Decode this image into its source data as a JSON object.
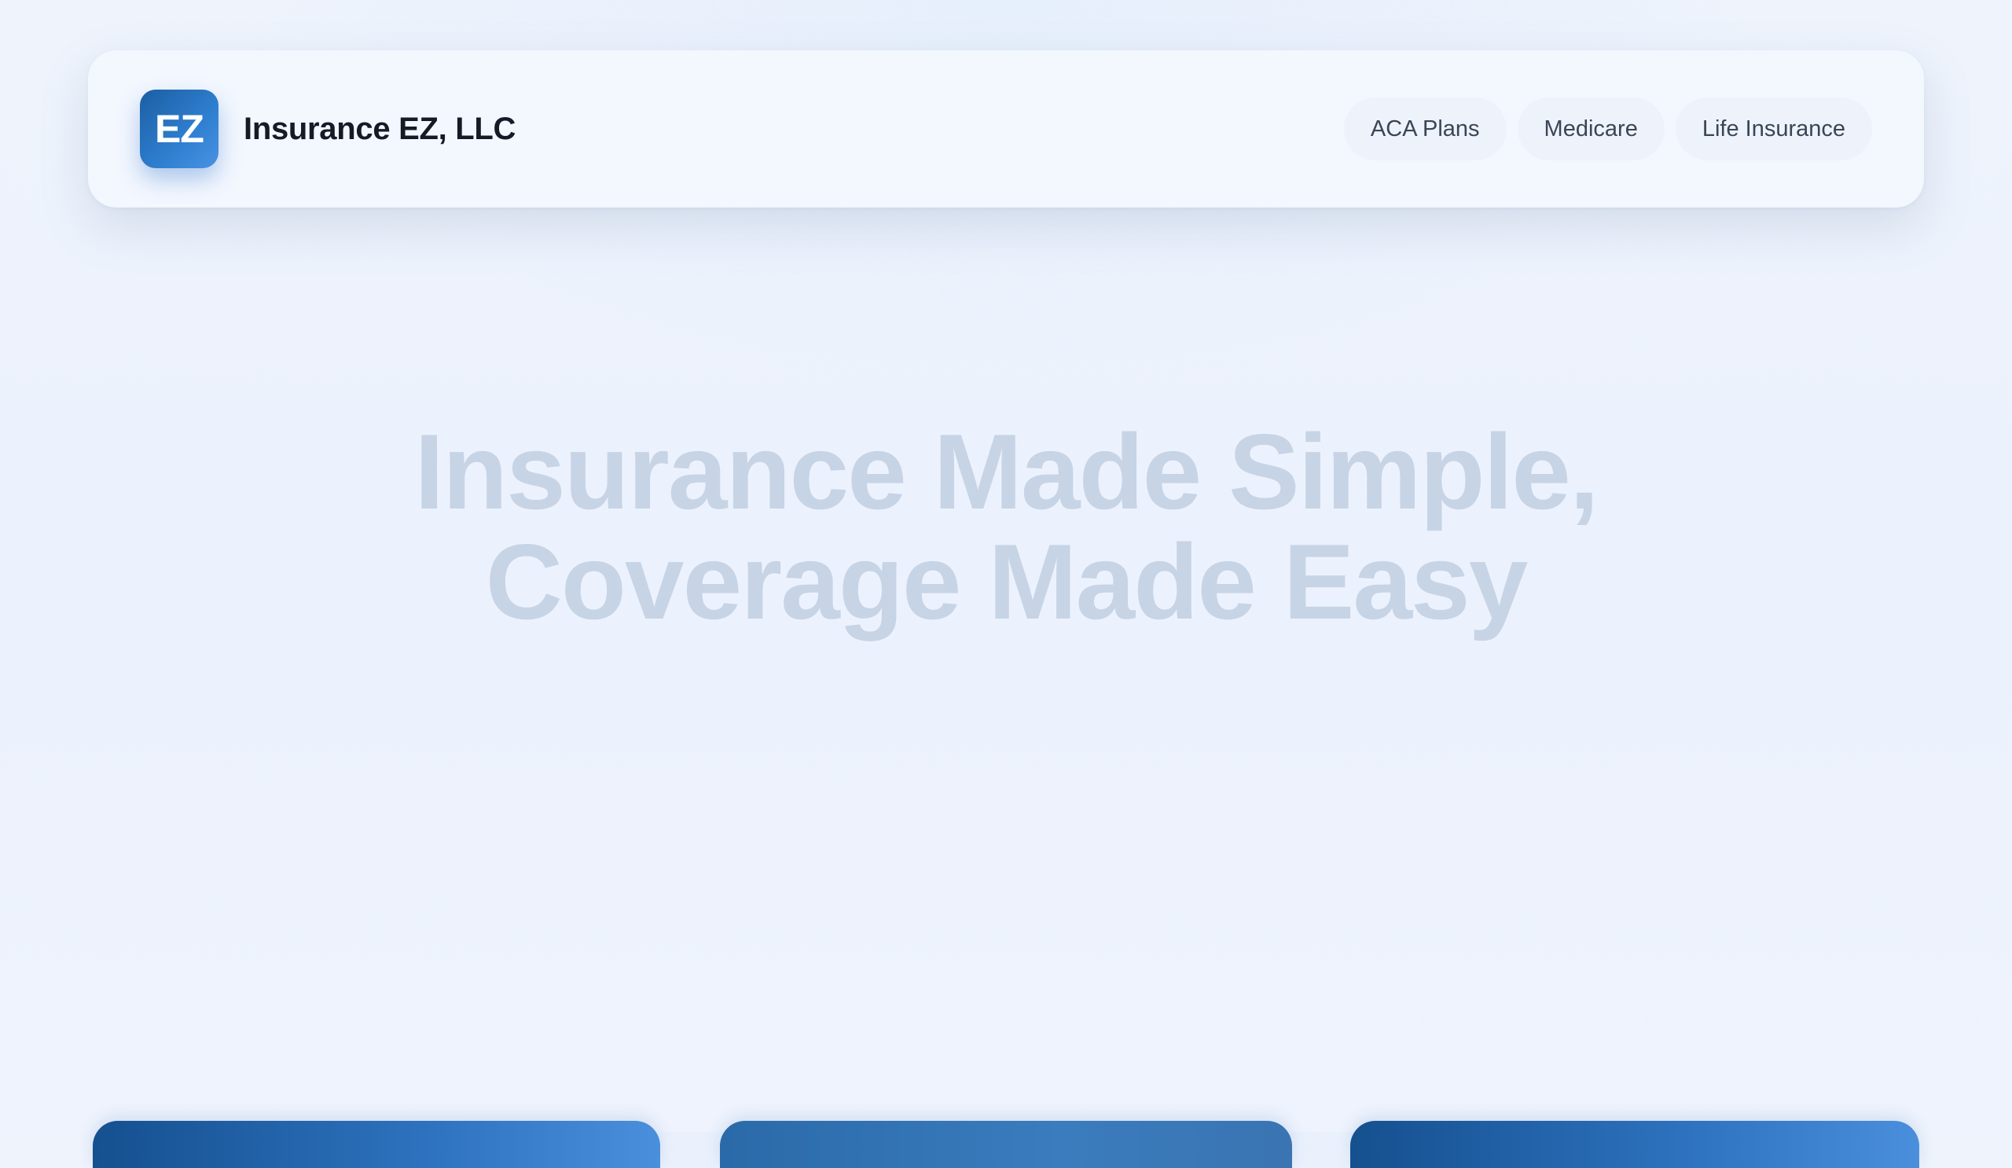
{
  "header": {
    "logo_text": "EZ",
    "brand_name": "Insurance EZ, LLC",
    "nav": [
      {
        "label": "ACA Plans"
      },
      {
        "label": "Medicare"
      },
      {
        "label": "Life Insurance"
      }
    ]
  },
  "hero": {
    "title_line_1": "Insurance Made Simple,",
    "title_line_2": "Coverage Made Easy"
  },
  "colors": {
    "brand_blue": "#1b5ea3",
    "accent_blue": "#4a92e2",
    "hero_text": "#c7d4e5",
    "background": "#eef3fc"
  }
}
